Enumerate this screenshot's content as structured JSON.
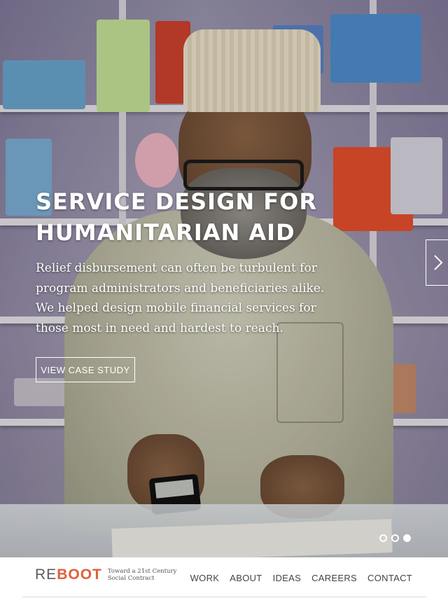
{
  "hero": {
    "title": "SERVICE DESIGN FOR\nHUMANITARIAN AID",
    "description": "Relief disbursement can often be turbulent for\nprogram administrators and beneficiaries alike.\nWe helped design mobile financial services for\nthose most in need and hardest to reach.",
    "cta_label": "VIEW CASE STUDY",
    "next_icon": "chevron-right-icon",
    "slides_total": 3,
    "active_slide": 3
  },
  "footer": {
    "logo": {
      "re": "RE",
      "boot": "BOOT",
      "tagline": "Toward a 21st Century\nSocial Contract"
    },
    "nav": [
      {
        "label": "WORK"
      },
      {
        "label": "ABOUT"
      },
      {
        "label": "IDEAS"
      },
      {
        "label": "CAREERS"
      },
      {
        "label": "CONTACT"
      }
    ]
  },
  "colors": {
    "accent": "#e0603a",
    "logo_gray": "#5b5b5b",
    "nav_text": "#444444",
    "overlay_text": "#ffffff"
  }
}
